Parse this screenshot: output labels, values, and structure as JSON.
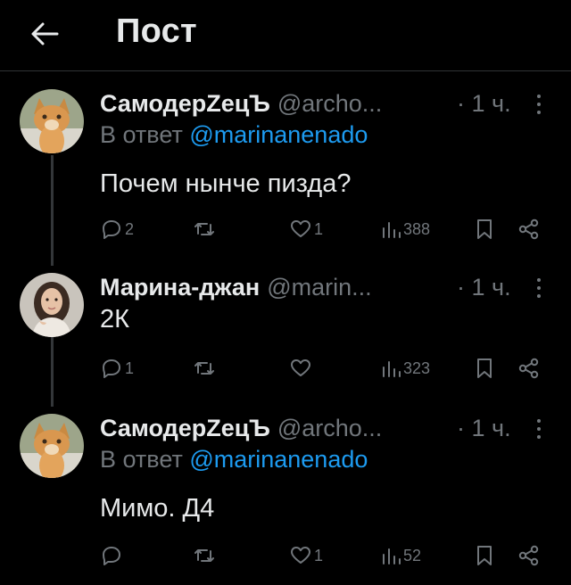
{
  "header": {
    "title": "Пост",
    "back_icon": "arrow-left-icon"
  },
  "colors": {
    "background": "#000000",
    "text": "#e7e9ea",
    "muted": "#71767b",
    "link": "#1d9bf0",
    "divider": "#2f3336"
  },
  "tweets": [
    {
      "author": "СамодерZецЪ",
      "handle": "@archo...",
      "time": "· 1 ч.",
      "reply_prefix": "В ответ ",
      "reply_to": "@marinanenado",
      "text": "Почем нынче пизда?",
      "replies": "2",
      "retweets": "",
      "likes": "1",
      "views": "388",
      "avatar_icon": "cat-avatar"
    },
    {
      "author": "Марина-джан",
      "handle": "@marin...",
      "time": "· 1 ч.",
      "reply_prefix": "",
      "reply_to": "",
      "text": "2К",
      "replies": "1",
      "retweets": "",
      "likes": "",
      "views": "323",
      "avatar_icon": "woman-avatar"
    },
    {
      "author": "СамодерZецЪ",
      "handle": "@archo...",
      "time": "· 1 ч.",
      "reply_prefix": "В ответ ",
      "reply_to": "@marinanenado",
      "text": "Мимо. Д4",
      "replies": "",
      "retweets": "",
      "likes": "1",
      "views": "52",
      "avatar_icon": "cat-avatar"
    }
  ]
}
